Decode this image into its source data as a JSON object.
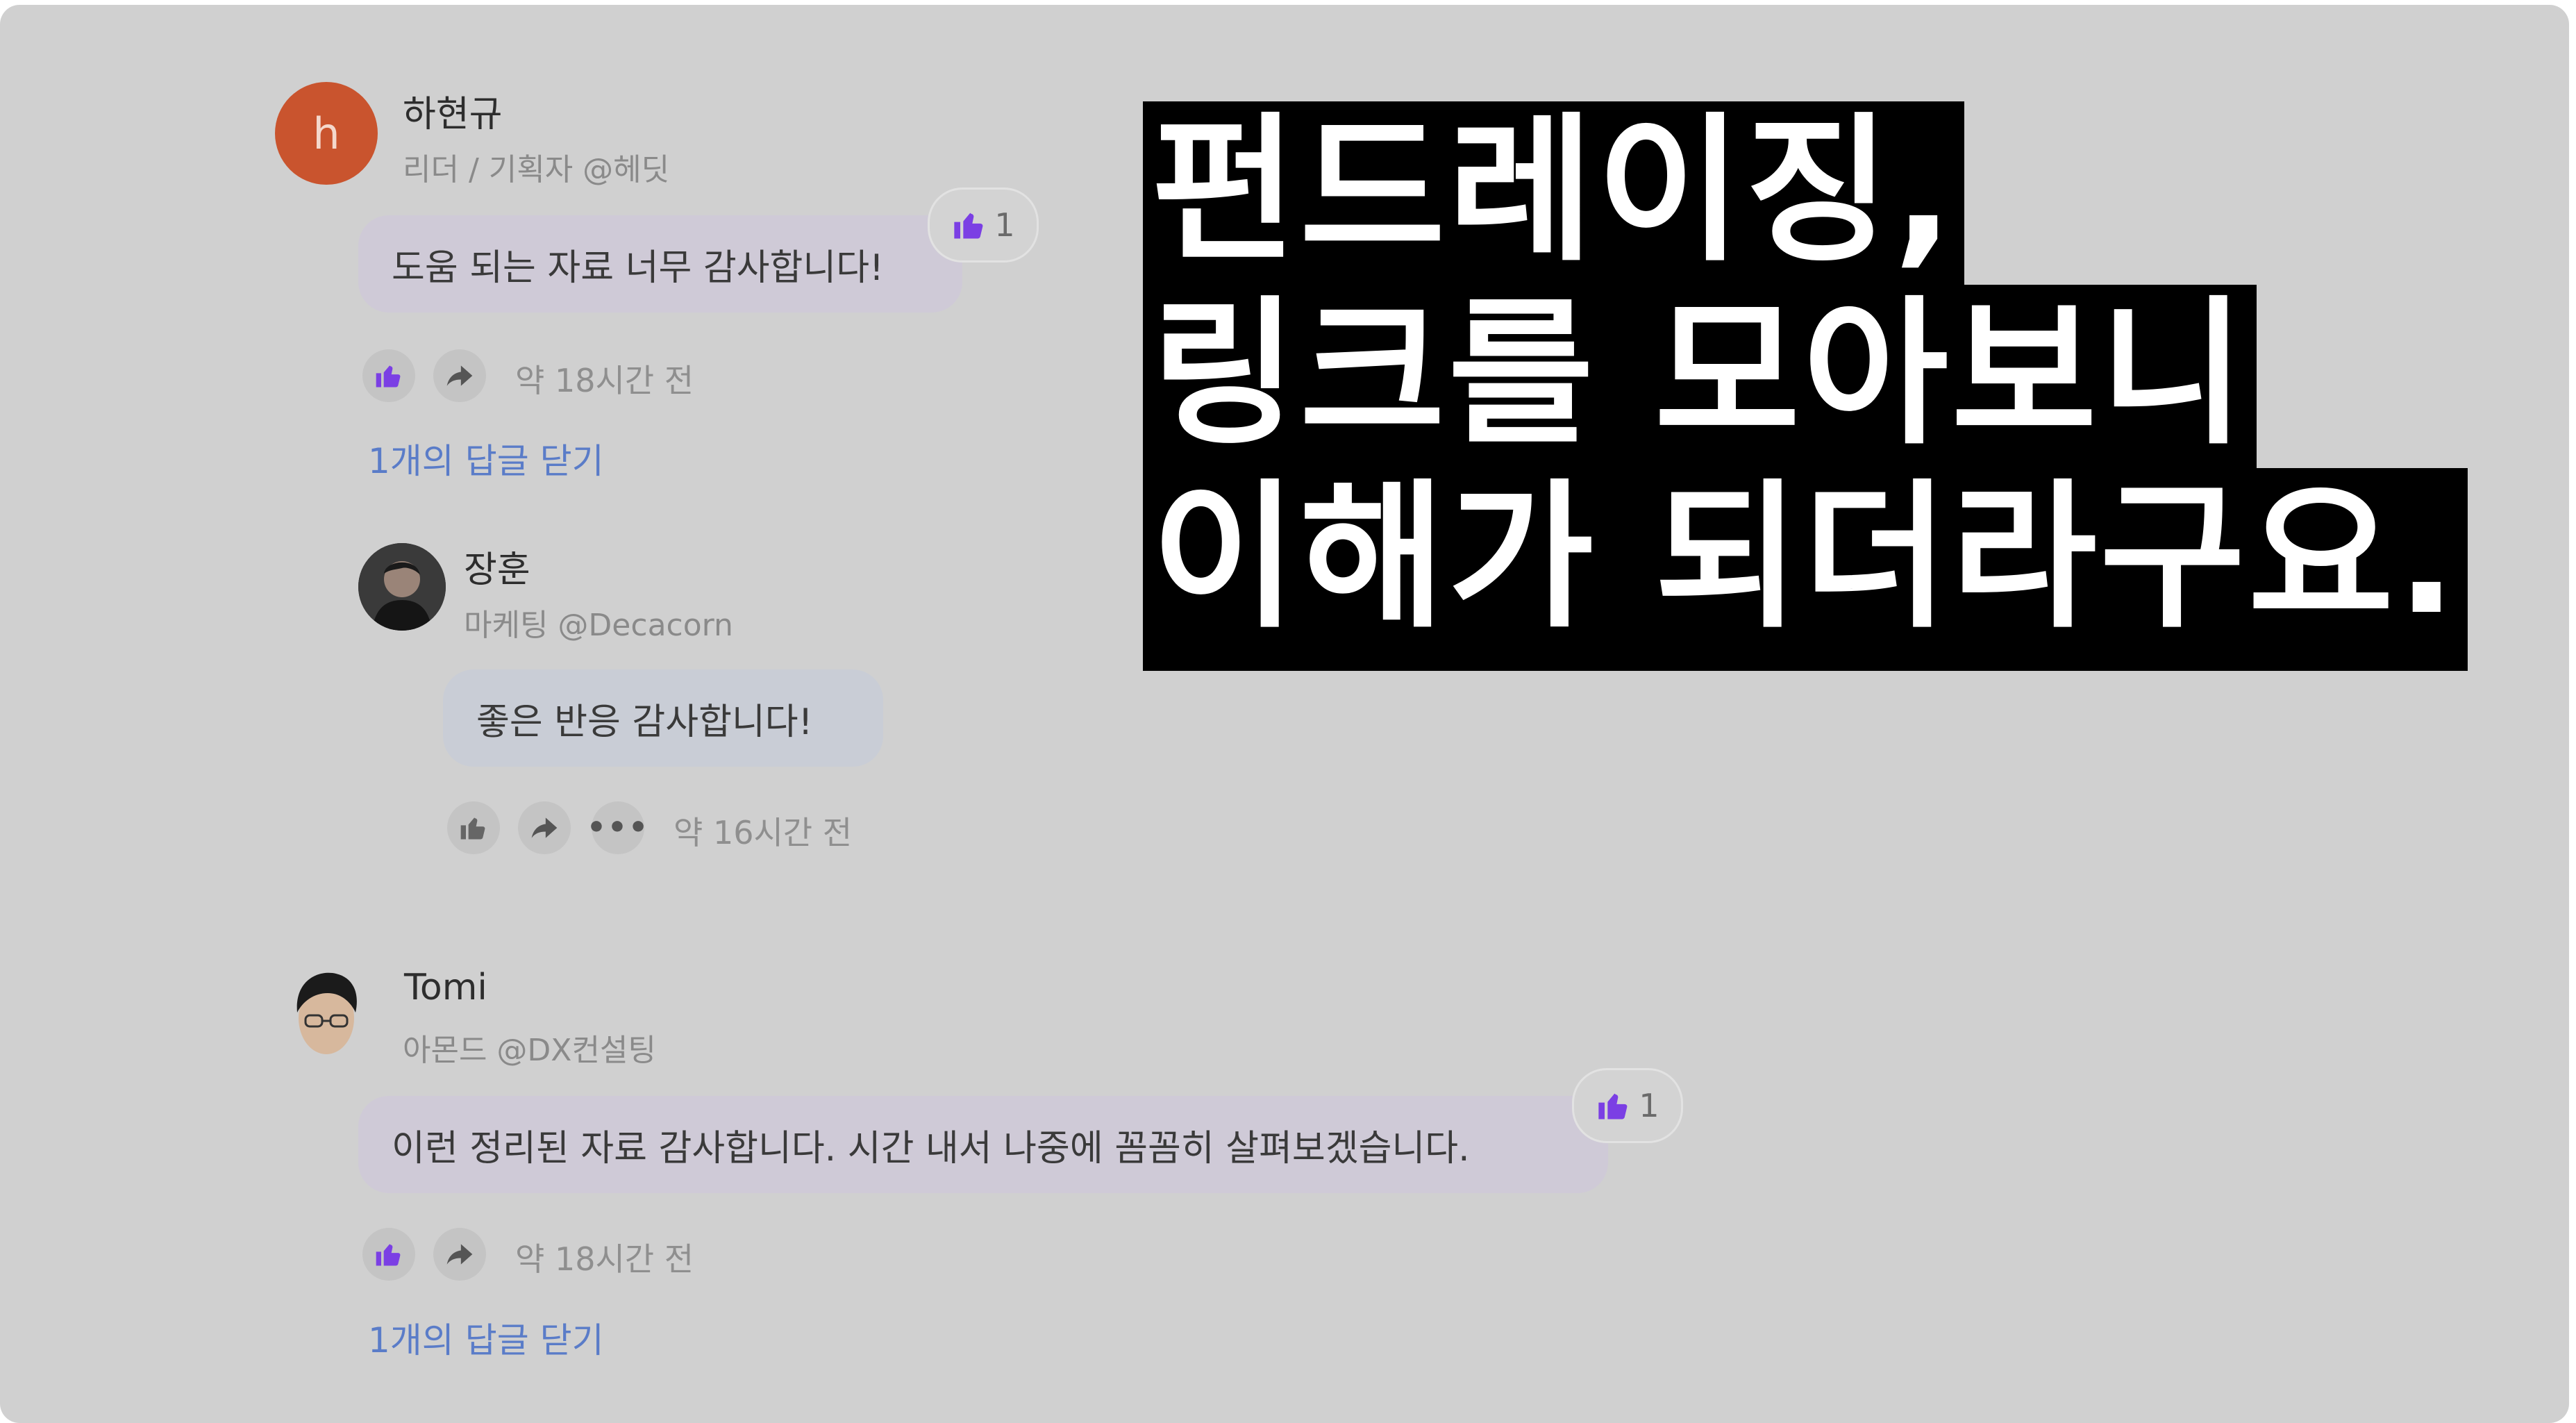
{
  "comments": [
    {
      "author": "하현규",
      "subtitle": "리더 / 기획자 @헤딧",
      "avatar_letter": "h",
      "text": "도움 되는 자료 너무 감사합니다!",
      "reaction_count": "1",
      "time": "약 18시간 전",
      "replies_link": "1개의 답글 닫기"
    },
    {
      "author": "장훈",
      "subtitle": "마케팅 @Decacorn",
      "text": "좋은 반응 감사합니다!",
      "time": "약 16시간 전"
    },
    {
      "author": "Tomi",
      "subtitle": "아몬드 @DX컨설팅",
      "text": "이런 정리된 자료 감사합니다. 시간 내서 나중에 꼼꼼히 살펴보겠습니다.",
      "reaction_count": "1",
      "time": "약 18시간 전",
      "replies_link": "1개의 답글 닫기"
    }
  ],
  "overlay": {
    "line1": "펀드레이징,",
    "line2": "링크를 모아보니",
    "line3": "이해가 되더라구요."
  },
  "colors": {
    "background": "#d0d0d0",
    "bubble_lavender": "#cfcad7",
    "bubble_blue": "#c9cdd6",
    "accent_purple": "#7b3fe4",
    "link_blue": "#5a7cc8",
    "avatar_orange": "#c9542e"
  },
  "icons": {
    "like": "thumbs-up-icon",
    "share": "share-arrow-icon",
    "more": "more-dots-icon"
  }
}
